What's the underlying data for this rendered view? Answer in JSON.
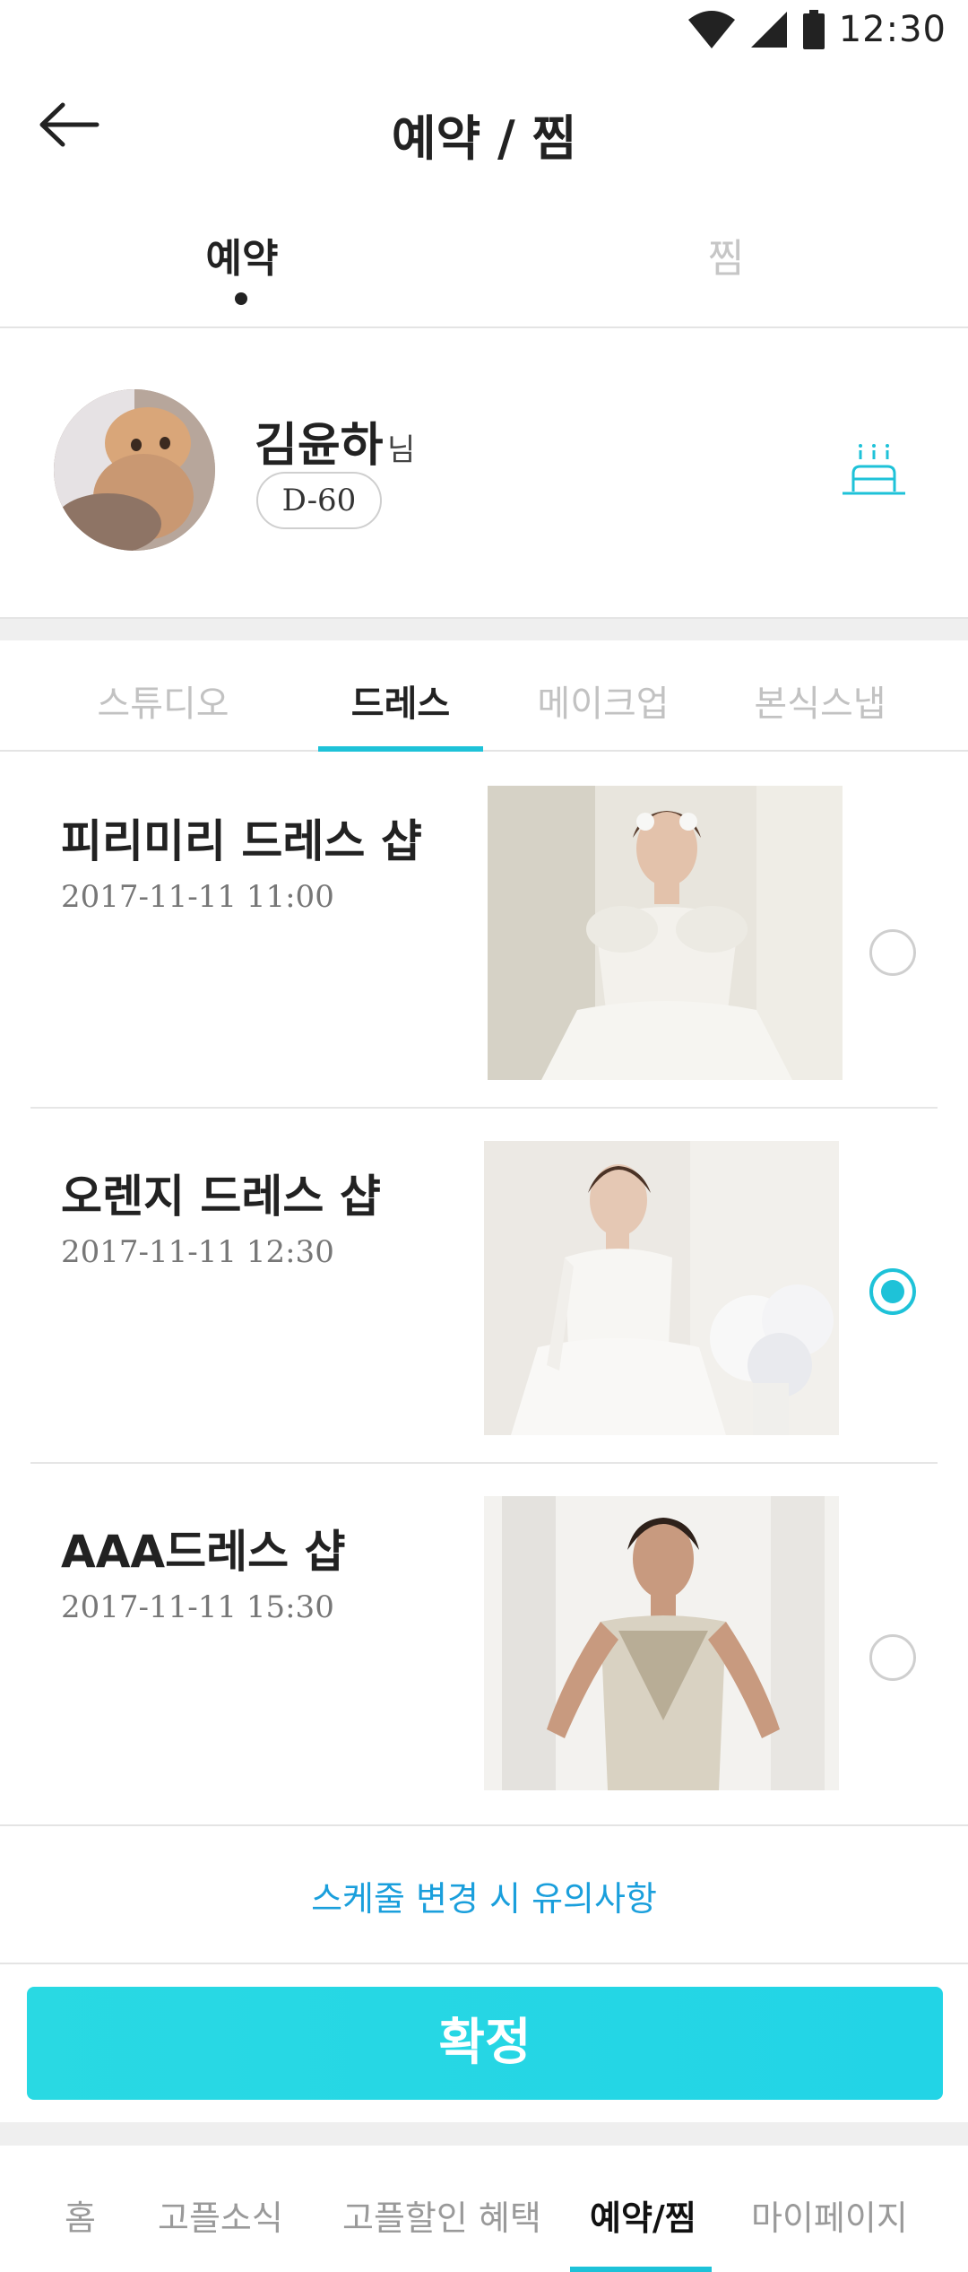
{
  "status_bar": {
    "time": "12:30",
    "icons": [
      "wifi-icon",
      "signal-icon",
      "battery-icon"
    ]
  },
  "header": {
    "title": "예약 / 찜",
    "back_icon": "back-arrow-icon"
  },
  "top_tabs": [
    {
      "label": "예약",
      "active": true
    },
    {
      "label": "찜",
      "active": false
    }
  ],
  "profile": {
    "name": "김윤하",
    "suffix": "님",
    "dday": "D-60",
    "action_icon": "cake-icon"
  },
  "category_tabs": [
    {
      "label": "스튜디오",
      "active": false
    },
    {
      "label": "드레스",
      "active": true
    },
    {
      "label": "메이크업",
      "active": false
    },
    {
      "label": "본식스냅",
      "active": false
    }
  ],
  "items": [
    {
      "name": "피리미리 드레스 샵",
      "datetime": "2017-11-11 11:00",
      "selected": false
    },
    {
      "name": "오렌지 드레스 샵",
      "datetime": "2017-11-11 12:30",
      "selected": true
    },
    {
      "name": "AAA드레스 샵",
      "datetime": "2017-11-11 15:30",
      "selected": false
    }
  ],
  "notice": {
    "label": "스케줄 변경 시 유의사항"
  },
  "confirm": {
    "label": "확정"
  },
  "bottom_nav": [
    {
      "label": "홈",
      "active": false
    },
    {
      "label": "고플소식",
      "active": false
    },
    {
      "label": "고플할인 혜택",
      "active": false
    },
    {
      "label": "예약/찜",
      "active": true
    },
    {
      "label": "마이페이지",
      "active": false
    }
  ],
  "colors": {
    "accent": "#1ec2d8",
    "link": "#1a9fdc",
    "button": "#22d4e6"
  }
}
